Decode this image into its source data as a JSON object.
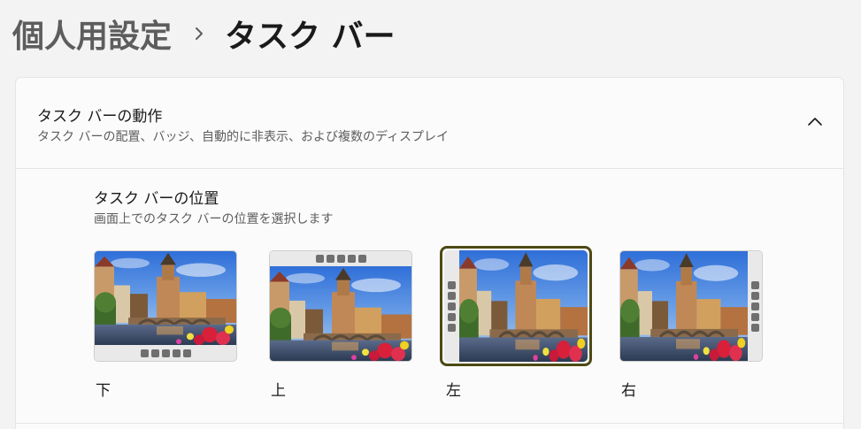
{
  "breadcrumb": {
    "parent": "個人用設定",
    "separator_icon": "chevron-right-icon",
    "current": "タスク バー"
  },
  "card": {
    "title": "タスク バーの動作",
    "description": "タスク バーの配置、バッジ、自動的に非表示、および複数のディスプレイ",
    "expand_icon": "chevron-up-icon"
  },
  "setting": {
    "title": "タスク バーの位置",
    "description": "画面上でのタスク バーの位置を選択します"
  },
  "options": [
    {
      "label": "下",
      "position": "bottom",
      "selected": false
    },
    {
      "label": "上",
      "position": "top",
      "selected": false
    },
    {
      "label": "左",
      "position": "left",
      "selected": true
    },
    {
      "label": "右",
      "position": "right",
      "selected": false
    }
  ],
  "colors": {
    "selection_ring": "#4d4a14",
    "taskbar": "#e9e9e9",
    "taskbar_icon": "#6f6f6f"
  }
}
